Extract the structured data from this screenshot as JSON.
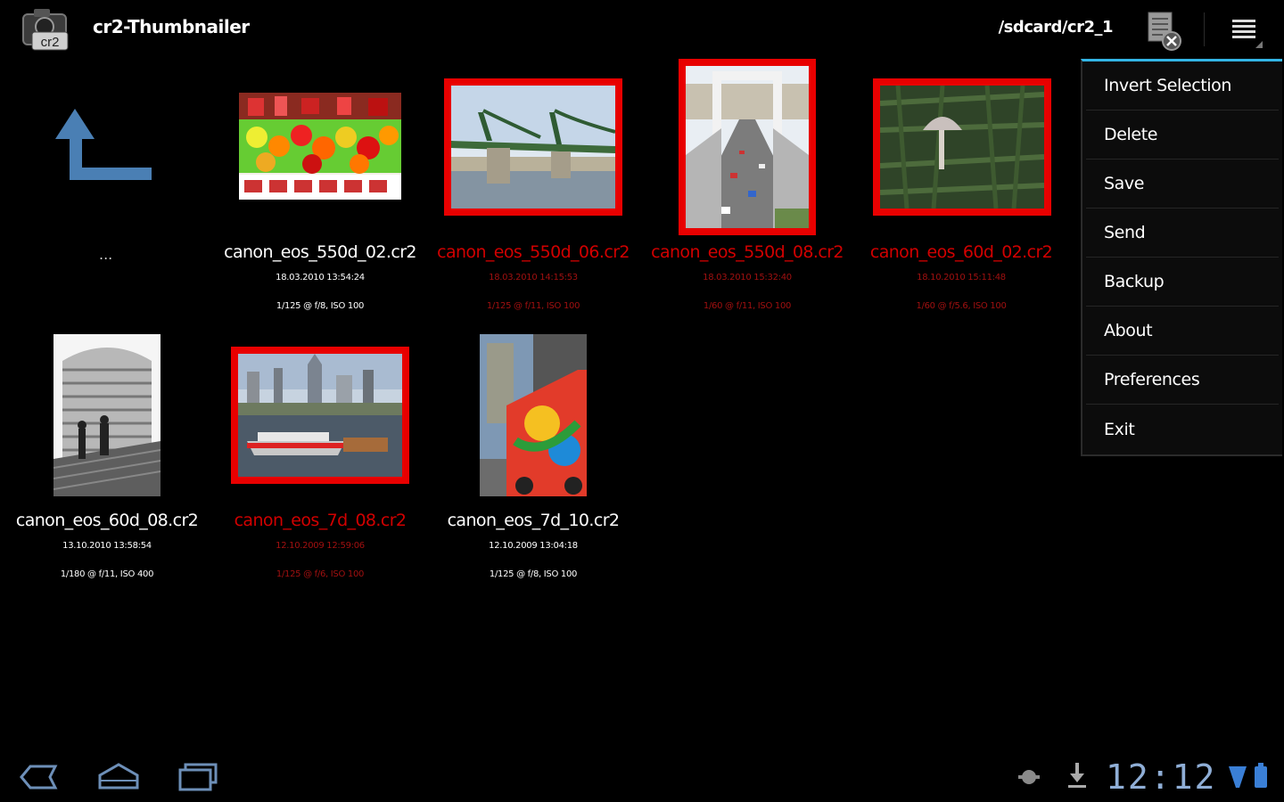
{
  "action_bar": {
    "app_title": "cr2-Thumbnailer",
    "app_icon_label": "cr2",
    "path": "/sdcard/cr2_1"
  },
  "navigation": {
    "up_label": "..."
  },
  "files": [
    {
      "name": "canon_eos_550d_02.cr2",
      "date": "18.03.2010 13:54:24",
      "exposure": "1/125 @ f/8, ISO 100",
      "selected": false
    },
    {
      "name": "canon_eos_550d_06.cr2",
      "date": "18.03.2010 14:15:53",
      "exposure": "1/125 @ f/11, ISO 100",
      "selected": true
    },
    {
      "name": "canon_eos_550d_08.cr2",
      "date": "18.03.2010 15:32:40",
      "exposure": "1/60 @ f/11, ISO 100",
      "selected": true
    },
    {
      "name": "canon_eos_60d_02.cr2",
      "date": "18.10.2010 15:11:48",
      "exposure": "1/60 @ f/5.6, ISO 100",
      "selected": true
    },
    {
      "name": "canon_eos_60d_08.cr2",
      "date": "13.10.2010 13:58:54",
      "exposure": "1/180 @ f/11, ISO 400",
      "selected": false
    },
    {
      "name": "canon_eos_7d_08.cr2",
      "date": "12.10.2009 12:59:06",
      "exposure": "1/125 @ f/6, ISO 100",
      "selected": true
    },
    {
      "name": "canon_eos_7d_10.cr2",
      "date": "12.10.2009 13:04:18",
      "exposure": "1/125 @ f/8, ISO 100",
      "selected": false
    }
  ],
  "menu": {
    "items": [
      "Invert Selection",
      "Delete",
      "Save",
      "Send",
      "Backup",
      "About",
      "Preferences",
      "Exit"
    ]
  },
  "system_bar": {
    "time": "12:12"
  },
  "colors": {
    "selection": "#e80000",
    "selected_text": "#d10000",
    "menu_accent": "#33b5e5",
    "clock": "#8faed6"
  }
}
